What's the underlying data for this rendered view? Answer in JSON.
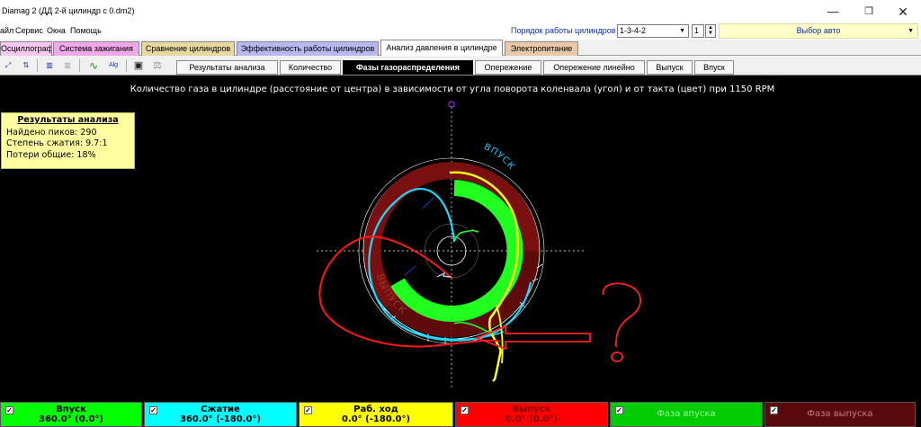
{
  "window": {
    "title": "Diamag 2 (ДД 2-й цилиндр с 0.dm2)",
    "minimize": "—",
    "maximize": "❐",
    "close": "✕"
  },
  "menu": {
    "items": [
      "айл",
      "Сервис",
      "Окна",
      "Помощь"
    ],
    "cylinder_order_label": "Порядок работы цилиндров",
    "cylinder_order_value": "1-3-4-2",
    "cylinder_value": "1",
    "auto_select": "Выбор авто"
  },
  "primary_tabs": [
    {
      "label": "Осциллограф",
      "color": "#f8c8f0"
    },
    {
      "label": "Система зажигания",
      "color": "#f0a8e8"
    },
    {
      "label": "Сравнение цилиндров",
      "color": "#e8d8a0"
    },
    {
      "label": "Эффективность работы цилиндров",
      "color": "#b8b8f0"
    },
    {
      "label": "Анализ давления в цилиндре",
      "color": "#ffffff"
    },
    {
      "label": "Электропитание",
      "color": "#e8c8a8"
    }
  ],
  "toolbar": {
    "subtabs": [
      "Результаты анализа",
      "Количество",
      "Фазы газораспределения",
      "Опережение",
      "Опережение линейно",
      "Выпуск",
      "Впуск"
    ],
    "active_subtab": "Фазы газораспределения",
    "icons": [
      "graph-zoom-icon",
      "graph-pan-icon",
      "bar-chart-icon",
      "disabled-bar-chart-icon",
      "trace-icon",
      "algorithm-icon",
      "save-icon",
      "scales-icon"
    ],
    "icon_glyphs": [
      "⤢",
      "⇅",
      "▥",
      "▥",
      "∿",
      "Alg",
      "▣",
      "⚖"
    ]
  },
  "plot": {
    "title": "Количество газа в цилиндре (расстояние от центра) в зависимости от угла поворота коленвала (угол) и от такта (цвет) при 1150 RPM",
    "intake_label": "ВПУСК",
    "exhaust_label": "ВЫПУСК",
    "colors": {
      "intake": "#20ff20",
      "exhaust": "#7a0f0f",
      "compression": "#20d8ff",
      "power": "#ffff20",
      "exhaust_trace": "#ff1818",
      "annotation": "#ff2020"
    }
  },
  "results": {
    "title": "Результаты анализа",
    "peaks": "Найдено пиков: 290",
    "compression": "Степень сжатия: 9.7:1",
    "losses": "Потери общие: 18%"
  },
  "legend": [
    {
      "name": "Впуск",
      "value": "360.0° (0.0°)",
      "bg": "#00ff00",
      "fg": "#000000",
      "checked": true
    },
    {
      "name": "Сжатие",
      "value": "360.0° (-180.0°)",
      "bg": "#00ffff",
      "fg": "#000000",
      "checked": true
    },
    {
      "name": "Раб. ход",
      "value": "0.0° (-180.0°)",
      "bg": "#ffff00",
      "fg": "#000000",
      "checked": true
    },
    {
      "name": "Выпуск",
      "value": "0.0° (0.0°)",
      "bg": "#ff0000",
      "fg": "#800000",
      "checked": true
    },
    {
      "name": "Фаза впуска",
      "value": "",
      "bg": "#00cc00",
      "fg": "#9cff9c",
      "checked": true
    },
    {
      "name": "Фаза выпуска",
      "value": "",
      "bg": "#5a0a0a",
      "fg": "#c87878",
      "checked": true
    }
  ],
  "check_mark": "✓"
}
